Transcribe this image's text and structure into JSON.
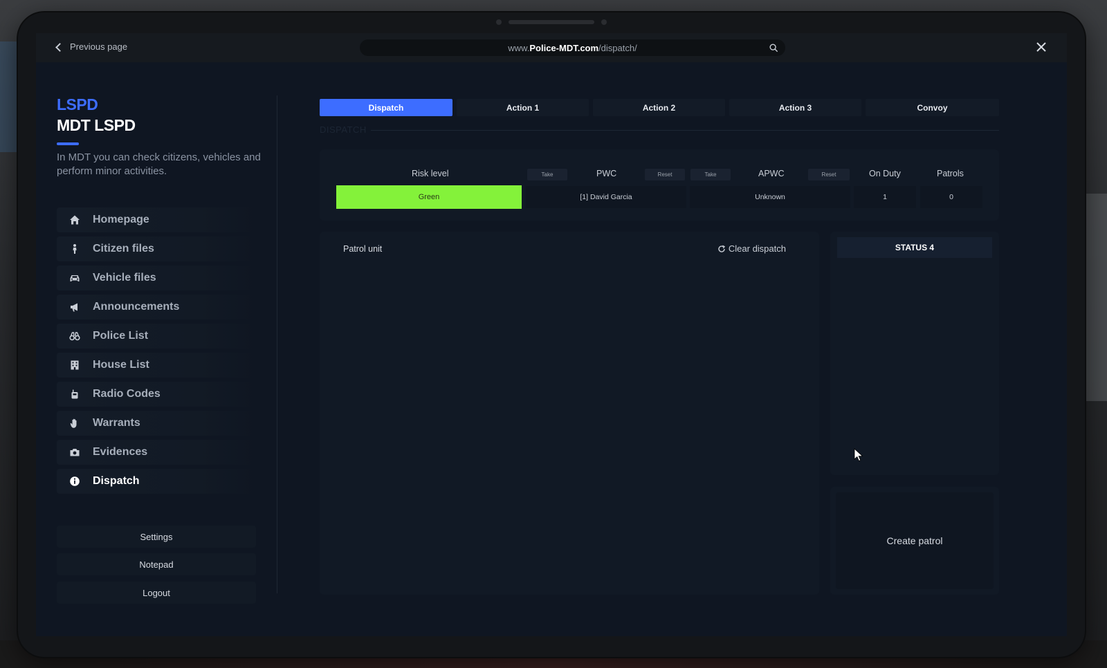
{
  "topbar": {
    "back_label": "Previous page",
    "url_prefix": "www.",
    "url_domain": "Police-MDT.com",
    "url_path": "/dispatch/"
  },
  "brand": {
    "top": "LSPD",
    "main": "MDT LSPD",
    "description": "In MDT you can check citizens, vehicles and perform minor activities."
  },
  "nav": {
    "items": [
      {
        "label": "Homepage",
        "icon": "home-icon"
      },
      {
        "label": "Citizen files",
        "icon": "person-icon"
      },
      {
        "label": "Vehicle files",
        "icon": "car-icon"
      },
      {
        "label": "Announcements",
        "icon": "megaphone-icon"
      },
      {
        "label": "Police List",
        "icon": "binoculars-icon"
      },
      {
        "label": "House List",
        "icon": "building-icon"
      },
      {
        "label": "Radio Codes",
        "icon": "radio-icon"
      },
      {
        "label": "Warrants",
        "icon": "hand-icon"
      },
      {
        "label": "Evidences",
        "icon": "camera-icon"
      },
      {
        "label": "Dispatch",
        "icon": "info-icon",
        "active": true
      }
    ],
    "settings": "Settings",
    "notepad": "Notepad",
    "logout": "Logout"
  },
  "tabs": [
    {
      "label": "Dispatch",
      "active": true
    },
    {
      "label": "Action 1"
    },
    {
      "label": "Action 2"
    },
    {
      "label": "Action 3"
    },
    {
      "label": "Convoy"
    }
  ],
  "section": {
    "label": "DISPATCH"
  },
  "info": {
    "risk_header": "Risk level",
    "risk_value": "Green",
    "risk_color": "#84f23a",
    "take_label": "Take",
    "reset_label": "Reset",
    "pwc_header": "PWC",
    "pwc_value": "[1] David Garcia",
    "apwc_header": "APWC",
    "apwc_value": "Unknown",
    "onduty_header": "On Duty",
    "onduty_value": "1",
    "patrols_header": "Patrols",
    "patrols_value": "0"
  },
  "patrol": {
    "title": "Patrol unit",
    "clear_label": "Clear dispatch"
  },
  "status": {
    "header": "STATUS 4"
  },
  "create": {
    "label": "Create patrol"
  },
  "colors": {
    "accent": "#3d6dff",
    "background": "#0f1622"
  }
}
